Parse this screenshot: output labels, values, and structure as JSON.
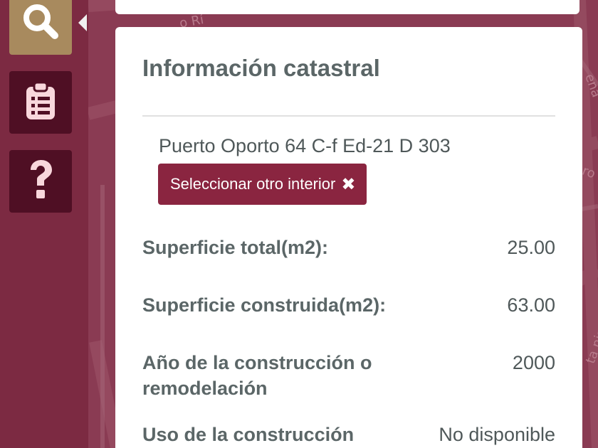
{
  "sidebar": {
    "items": [
      {
        "icon": "search-icon",
        "active": true
      },
      {
        "icon": "clipboard-list-icon",
        "active": false
      },
      {
        "icon": "question-icon",
        "active": false
      }
    ]
  },
  "map": {
    "labels": [
      "o Rí",
      "ena",
      "ro",
      "ta nia"
    ]
  },
  "panel": {
    "title": "Información catastral",
    "address": "Puerto Oporto 64 C-f Ed-21 D 303",
    "select_button_label": "Seleccionar otro interior",
    "rows": [
      {
        "label": "Superficie total(m2):",
        "value": "25.00"
      },
      {
        "label": "Superficie construida(m2):",
        "value": "63.00"
      },
      {
        "label": "Año de la construcción o remodelación",
        "value": "2000"
      },
      {
        "label": "Uso de la construcción",
        "value": "No disponible"
      }
    ]
  },
  "colors": {
    "sidebar_bg": "#7c2a42",
    "active_btn": "#a88a5e",
    "dark_btn": "#4f0f24",
    "accent_button": "#8a2540",
    "text": "#5b6667"
  }
}
